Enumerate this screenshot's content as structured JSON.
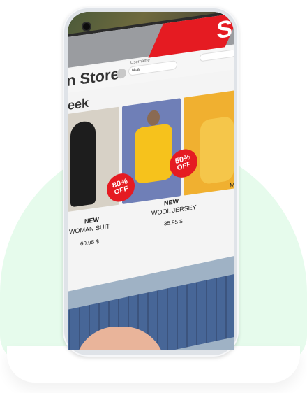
{
  "store": {
    "title": "n Store",
    "section_title": "eek",
    "username_label": "Username",
    "username_value": "Noa",
    "sale_letter": "S"
  },
  "products": [
    {
      "new_label": "NEW",
      "name": "WOMAN SUIT",
      "price": "60.95 $",
      "badge_pct": "80%",
      "badge_off": "OFF"
    },
    {
      "new_label": "NEW",
      "name": "WOOL JERSEY",
      "price": "35.95 $",
      "badge_pct": "50%",
      "badge_off": "OFF"
    },
    {
      "new_label": "",
      "name": "M",
      "price": "",
      "badge_pct": "",
      "badge_off": ""
    }
  ],
  "colors": {
    "sale_red": "#e51b22",
    "background_blob": "#e6fbec",
    "phone_frame": "#dfe3e8"
  }
}
